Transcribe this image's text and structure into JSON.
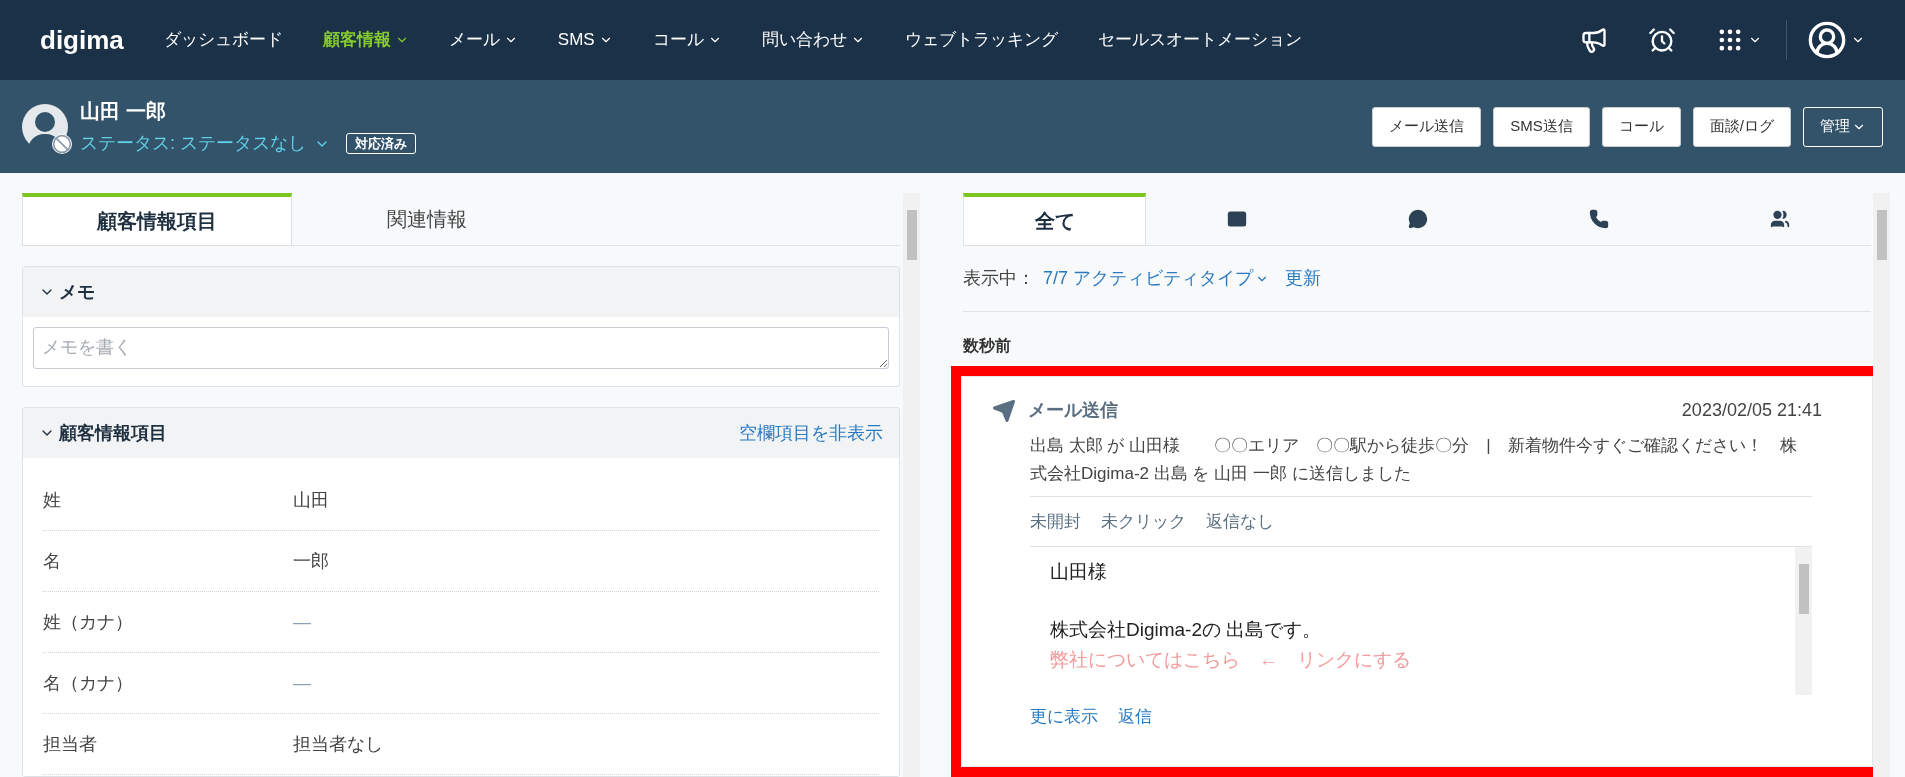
{
  "nav": {
    "logo": "digima",
    "items": [
      {
        "label": "ダッシュボード",
        "selected": false,
        "dropdown": false
      },
      {
        "label": "顧客情報",
        "selected": true,
        "dropdown": true
      },
      {
        "label": "メール",
        "selected": false,
        "dropdown": true
      },
      {
        "label": "SMS",
        "selected": false,
        "dropdown": true
      },
      {
        "label": "コール",
        "selected": false,
        "dropdown": true
      },
      {
        "label": "問い合わせ",
        "selected": false,
        "dropdown": true
      },
      {
        "label": "ウェブトラッキング",
        "selected": false,
        "dropdown": false
      },
      {
        "label": "セールスオートメーション",
        "selected": false,
        "dropdown": false
      }
    ]
  },
  "contact": {
    "name": "山田 一郎",
    "status": "ステータス: ステータスなし",
    "badge": "対応済み",
    "actions": [
      {
        "label": "メール送信",
        "dropdown": false
      },
      {
        "label": "SMS送信",
        "dropdown": false
      },
      {
        "label": "コール",
        "dropdown": false
      },
      {
        "label": "面談/ログ",
        "dropdown": false
      },
      {
        "label": "管理",
        "dropdown": true
      }
    ]
  },
  "left": {
    "tabs": [
      {
        "label": "顧客情報項目",
        "selected": true
      },
      {
        "label": "関連情報",
        "selected": false
      }
    ],
    "memo": {
      "title": "メモ",
      "expanded": true,
      "placeholder": "メモを書く"
    },
    "fields": {
      "title": "顧客情報項目",
      "expanded": true,
      "hide_empty": "空欄項目を非表示",
      "rows": [
        {
          "label": "姓",
          "value": "山田",
          "empty": false
        },
        {
          "label": "名",
          "value": "一郎",
          "empty": false
        },
        {
          "label": "姓（カナ）",
          "value": "—",
          "empty": true
        },
        {
          "label": "名（カナ）",
          "value": "—",
          "empty": true
        },
        {
          "label": "担当者",
          "value": "担当者なし",
          "empty": false
        }
      ]
    }
  },
  "right": {
    "tabs": [
      {
        "kind": "all",
        "label": "全て",
        "selected": true
      },
      {
        "kind": "mail",
        "selected": false
      },
      {
        "kind": "chat",
        "selected": false
      },
      {
        "kind": "phone",
        "selected": false
      },
      {
        "kind": "meeting",
        "selected": false
      }
    ],
    "filter_label": "表示中：",
    "filter_value": "7/7 アクティビティタイプ",
    "refresh": "更新",
    "group": "数秒前",
    "activity": {
      "type": "メール送信",
      "time": "2023/02/05 21:41",
      "summary": "出島 太郎 が 山田様　　〇〇エリア　〇〇駅から徒歩〇分　|　新着物件今すぐご確認ください！　株式会社Digima-2 出島 を 山田 一郎 に送信しました",
      "statuses": [
        "未開封",
        "未クリック",
        "返信なし"
      ],
      "body": [
        {
          "text": "山田様",
          "kind": "text"
        },
        {
          "kind": "blank"
        },
        {
          "text": "株式会社Digima-2の 出島です。",
          "kind": "text"
        },
        {
          "text": "弊社についてはこちら　←　リンクにする",
          "kind": "note"
        }
      ],
      "links": [
        "更に表示",
        "返信"
      ]
    }
  }
}
